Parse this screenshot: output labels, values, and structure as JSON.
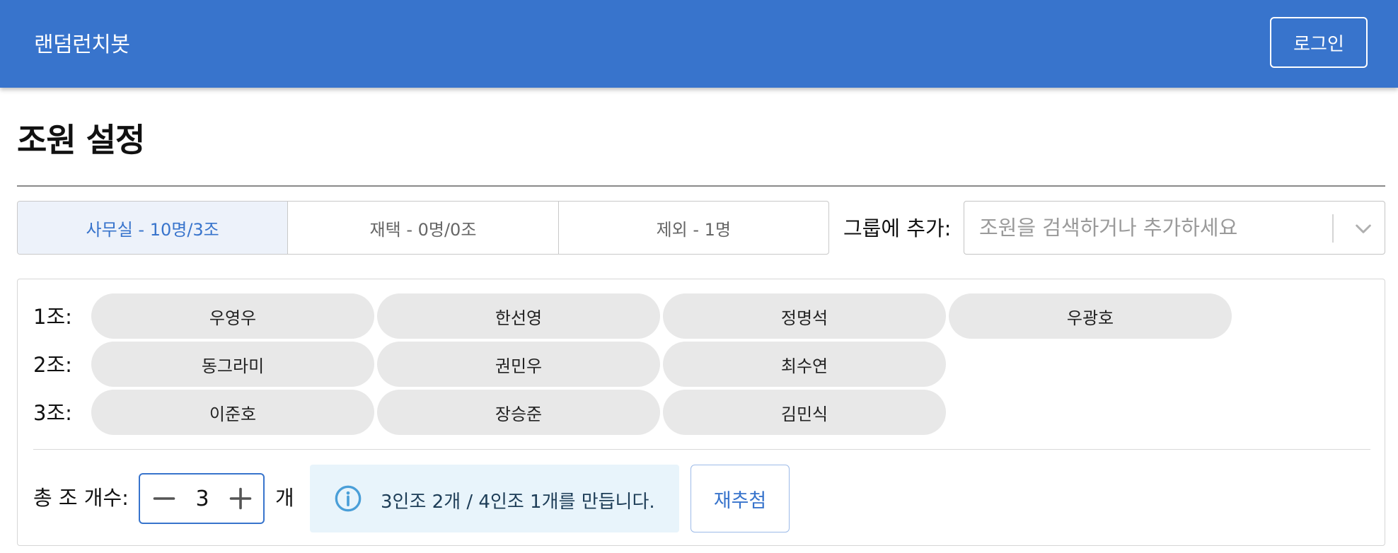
{
  "app": {
    "title": "랜덤런치봇",
    "login_label": "로그인"
  },
  "page": {
    "title": "조원 설정"
  },
  "tabs": [
    {
      "label": "사무실 - 10명/3조",
      "active": true
    },
    {
      "label": "재택 - 0명/0조",
      "active": false
    },
    {
      "label": "제외 - 1명",
      "active": false
    }
  ],
  "add_group": {
    "label": "그룹에 추가:",
    "placeholder": "조원을 검색하거나 추가하세요",
    "value": ""
  },
  "groups": [
    {
      "label": "1조:",
      "members": [
        "우영우",
        "한선영",
        "정명석",
        "우광호"
      ]
    },
    {
      "label": "2조:",
      "members": [
        "동그라미",
        "권민우",
        "최수연"
      ]
    },
    {
      "label": "3조:",
      "members": [
        "이준호",
        "장승준",
        "김민식"
      ]
    }
  ],
  "controls": {
    "count_label": "총 조 개수:",
    "count_value": "3",
    "unit": "개",
    "info_text": "3인조 2개 / 4인조 1개를 만듭니다.",
    "redraw_label": "재추첨"
  },
  "icons": {
    "minus": "minus-icon",
    "plus": "plus-icon",
    "info": "info-icon",
    "chevron": "chevron-down-icon"
  },
  "colors": {
    "primary": "#3874cc",
    "chip_bg": "#e8e8e8",
    "tab_active_bg": "#edf2fa",
    "info_bg": "#e8f4fb",
    "info_icon": "#4a9fd8"
  }
}
